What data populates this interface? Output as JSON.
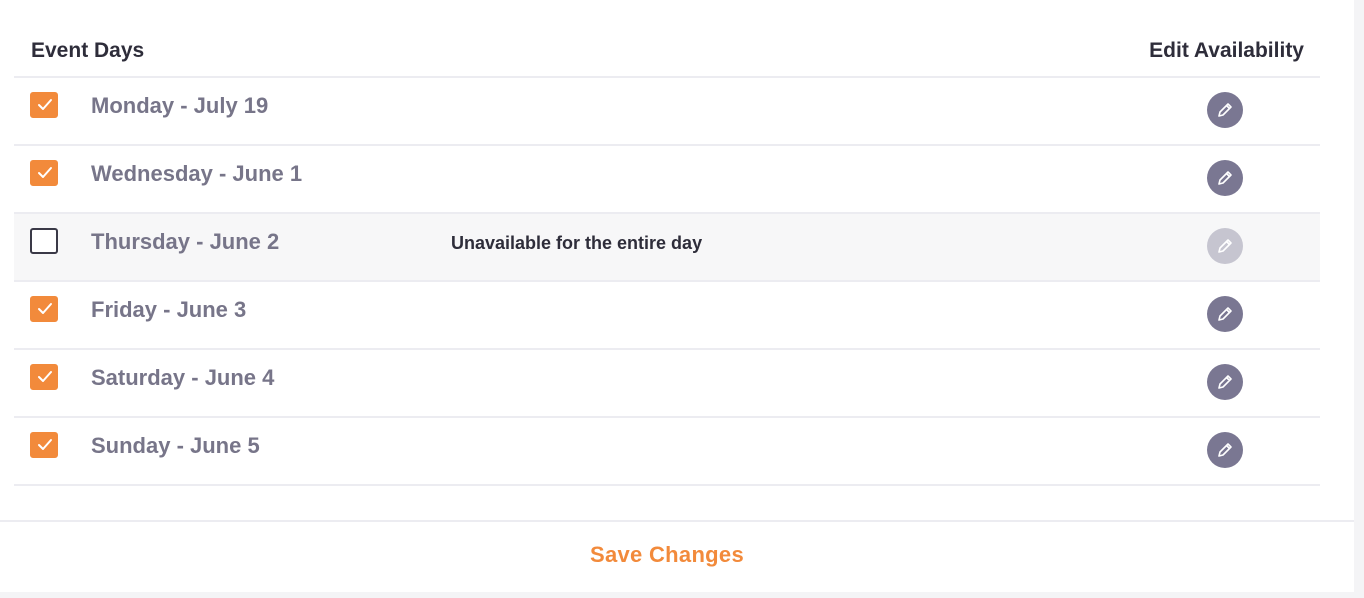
{
  "table": {
    "header_left": "Event Days",
    "header_right": "Edit Availability"
  },
  "days": [
    {
      "label": "Monday - July 19",
      "checked": true,
      "status": "",
      "edit_enabled": true
    },
    {
      "label": "Wednesday - June 1",
      "checked": true,
      "status": "",
      "edit_enabled": true
    },
    {
      "label": "Thursday - June 2",
      "checked": false,
      "status": "Unavailable for the entire day",
      "edit_enabled": false
    },
    {
      "label": "Friday - June 3",
      "checked": true,
      "status": "",
      "edit_enabled": true
    },
    {
      "label": "Saturday - June 4",
      "checked": true,
      "status": "",
      "edit_enabled": true
    },
    {
      "label": "Sunday - June 5",
      "checked": true,
      "status": "",
      "edit_enabled": true
    }
  ],
  "footer": {
    "save_label": "Save Changes"
  },
  "icons": {
    "checkbox": "check-icon",
    "edit": "pencil-icon"
  },
  "colors": {
    "accent": "#f28a3b",
    "edit_button": "#7a7792",
    "edit_button_disabled": "#c6c5d0",
    "text_primary": "#2e2d3a",
    "text_secondary": "#777589"
  }
}
